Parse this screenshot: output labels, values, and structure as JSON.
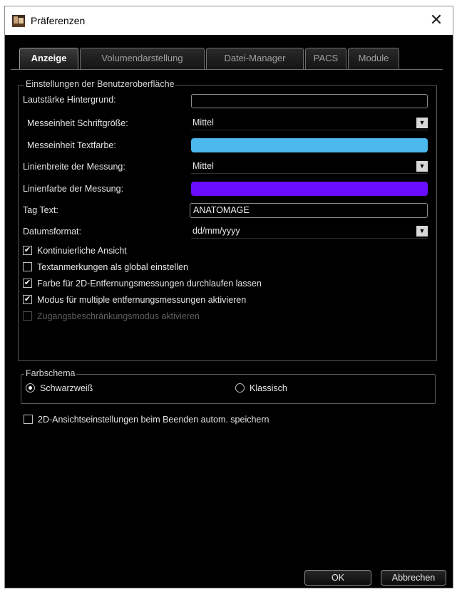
{
  "window": {
    "title": "Präferenzen",
    "close_glyph": "✕",
    "app_icon": "anatomage-app-icon"
  },
  "tabs": [
    {
      "label": "Anzeige",
      "active": true
    },
    {
      "label": "Volumendarstellung",
      "active": false
    },
    {
      "label": "Datei-Manager",
      "active": false
    },
    {
      "label": "PACS",
      "active": false
    },
    {
      "label": "Module",
      "active": false
    }
  ],
  "ui_settings": {
    "group_label": "Einstellungen der Benutzeroberfläche",
    "background_volume_label": "Lautstärke Hintergrund:",
    "font_size_label": "Messeinheit Schriftgröße:",
    "font_size_value": "Mittel",
    "text_color_label": "Messeinheit Textfarbe:",
    "text_color_value": "#4bb8ee",
    "line_width_label": "Linienbreite der Messung:",
    "line_width_value": "Mittel",
    "line_color_label": "Linienfarbe der Messung:",
    "line_color_value": "#6a0dff",
    "tag_text_label": "Tag Text:",
    "tag_text_value": "ANATOMAGE",
    "date_format_label": "Datumsformat:",
    "date_format_value": "dd/mm/yyyy",
    "checkboxes": [
      {
        "label": "Kontinuierliche Ansicht",
        "checked": true,
        "enabled": true
      },
      {
        "label": "Textanmerkungen als global einstellen",
        "checked": false,
        "enabled": true
      },
      {
        "label": "Farbe für 2D-Entfernungsmessungen durchlaufen lassen",
        "checked": true,
        "enabled": true
      },
      {
        "label": "Modus für multiple entfernungsmessungen aktivieren",
        "checked": true,
        "enabled": true
      },
      {
        "label": "Zugangsbeschränkungsmodus aktivieren",
        "checked": false,
        "enabled": false
      }
    ]
  },
  "color_scheme": {
    "group_label": "Farbschema",
    "options": [
      {
        "label": "Schwarzweiß",
        "selected": true
      },
      {
        "label": "Klassisch",
        "selected": false
      }
    ]
  },
  "autosave": {
    "label": "2D-Ansichtseinstellungen beim Beenden autom. speichern",
    "checked": false
  },
  "buttons": {
    "ok": "OK",
    "cancel": "Abbrechen"
  },
  "dropdown_arrow": "▼",
  "check_glyph": "✔"
}
